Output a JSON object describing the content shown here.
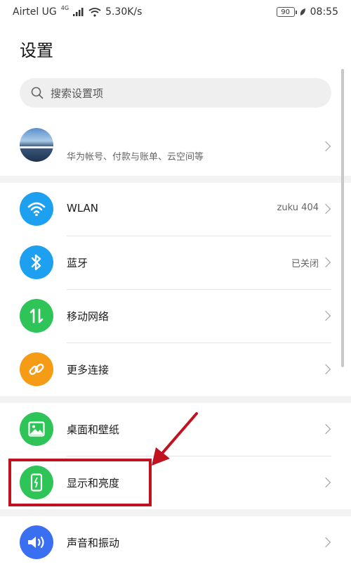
{
  "status_bar": {
    "carrier": "Airtel UG",
    "network": "4G",
    "speed": "5.30K/s",
    "battery": "90",
    "time": "08:55"
  },
  "title": "设置",
  "search": {
    "placeholder": "搜索设置项"
  },
  "account": {
    "subtitle": "华为帐号、付款与账单、云空间等"
  },
  "items": [
    {
      "label": "WLAN",
      "value": "zuku 404",
      "icon": "wifi-icon",
      "color": "#1ea0f0"
    },
    {
      "label": "蓝牙",
      "value": "已关闭",
      "icon": "bluetooth-icon",
      "color": "#1ea0f0"
    },
    {
      "label": "移动网络",
      "value": "",
      "icon": "mobile-data-icon",
      "color": "#2ec458"
    },
    {
      "label": "更多连接",
      "value": "",
      "icon": "link-icon",
      "color": "#f59b16"
    },
    {
      "label": "桌面和壁纸",
      "value": "",
      "icon": "image-icon",
      "color": "#2ec458"
    },
    {
      "label": "显示和亮度",
      "value": "",
      "icon": "display-icon",
      "color": "#2ec458"
    },
    {
      "label": "声音和振动",
      "value": "",
      "icon": "speaker-icon",
      "color": "#3a6ff2"
    }
  ],
  "annotation": {
    "color": "#c1121f"
  }
}
